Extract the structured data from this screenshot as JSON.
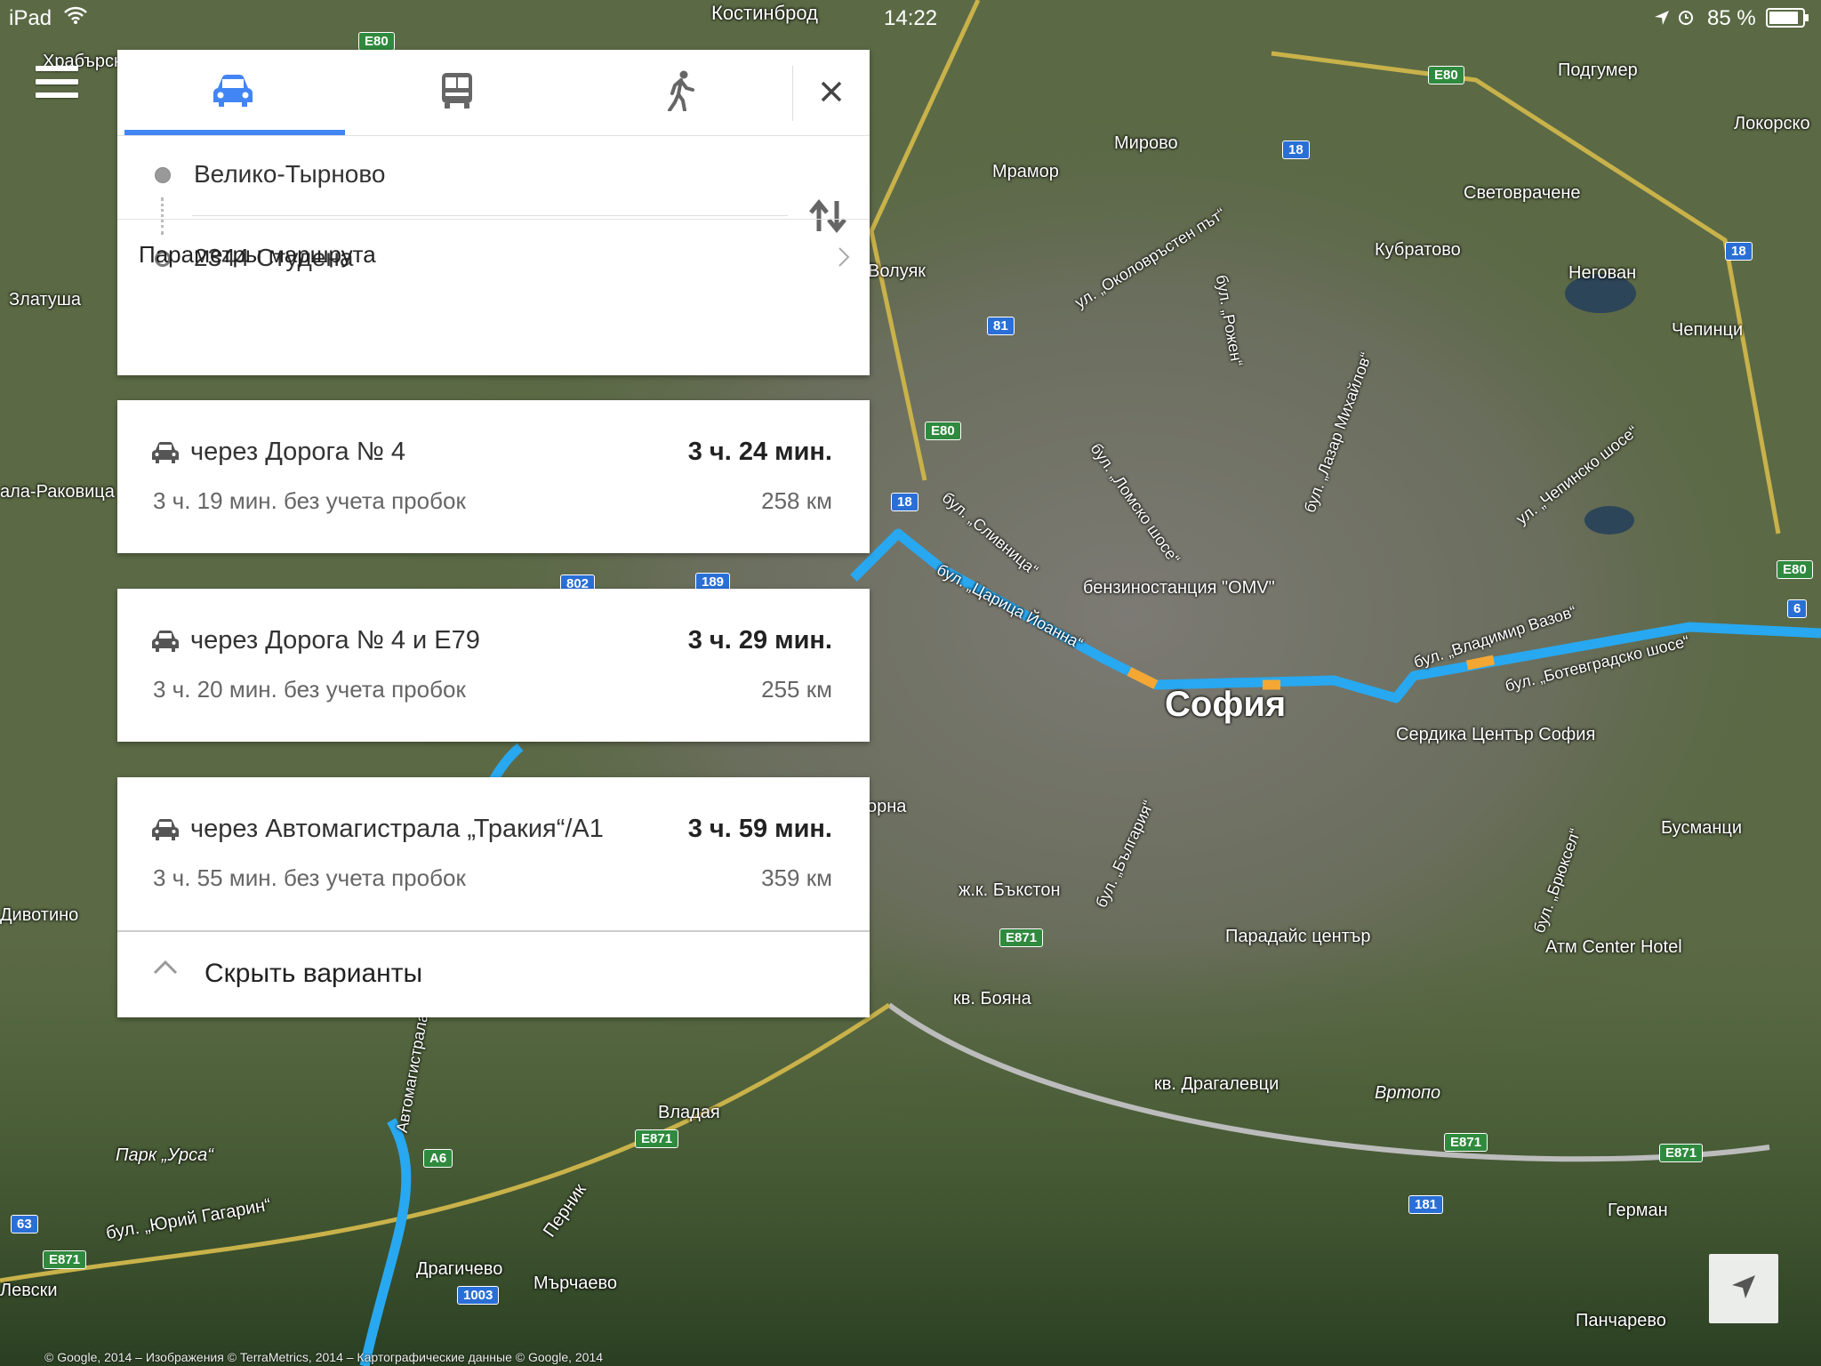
{
  "status_bar": {
    "device": "iPad",
    "time": "14:22",
    "battery": "85 %"
  },
  "modes": [
    {
      "name": "car-tab",
      "icon": "car-icon",
      "active": true
    },
    {
      "name": "transit-tab",
      "icon": "bus-icon",
      "active": false
    },
    {
      "name": "walk-tab",
      "icon": "walk-icon",
      "active": false
    }
  ],
  "route": {
    "origin": "Велико-Тырново",
    "destination": "2344 Студена"
  },
  "params_label": "Параметры маршрута",
  "options": [
    {
      "via": "через Дорога № 4",
      "duration": "3 ч. 24 мин.",
      "sub": "3 ч. 19 мин. без учета пробок",
      "distance": "258 км"
    },
    {
      "via": "через Дорога № 4 и E79",
      "duration": "3 ч. 29 мин.",
      "sub": "3 ч. 20 мин. без учета пробок",
      "distance": "255 км"
    },
    {
      "via": "через Автомагистрала „Тракия“/A1",
      "duration": "3 ч. 59 мин.",
      "sub": "3 ч. 55 мин. без учета пробок",
      "distance": "359 км"
    }
  ],
  "hide_label": "Скрыть варианты",
  "map": {
    "city": "София",
    "places": [
      "Костинброд",
      "Храбърско",
      "Мирово",
      "Мрамор",
      "Подгумер",
      "Локорско",
      "Световрачене",
      "Кубратово",
      "Негован",
      "Чепинци",
      "Волуяк",
      "Златуша",
      "ала-Раковица",
      "бензиностанция \"OMV\"",
      "Сердика Център София",
      "Бусманци",
      "ж.к. Бъкстон",
      "Парадайс център",
      "Атм Center Hotel",
      "кв. Бояна",
      "кв. Драгалевци",
      "Вртопо",
      "Дивотино",
      "Парк „Урса“",
      "Владая",
      "Драгичево",
      "Мърчаево",
      "Герман",
      "Панчарево",
      "Перник",
      "бул. „Юрий Гагарин“",
      "Левски",
      "орна"
    ],
    "roads": [
      "E80",
      "18",
      "81",
      "802",
      "189",
      "6",
      "E871",
      "A6",
      "63",
      "1003",
      "181"
    ],
    "streets": [
      "ул. „Околовръстен път“",
      "бул. „Лазар Михайлов“",
      "бул. „Ломско шосе“",
      "бул. „Сливница“",
      "бул. „Царица Йоанна“",
      "бул. „Владимир Вазов“",
      "бул. „Ботевградско шосе“",
      "ул. „Чепинско шосе“",
      "бул. „България“",
      "бул. „Брюксел“",
      "Автомагистрала",
      "бул. „Рожен“"
    ],
    "copyright": "© Google, 2014 – Изображения © TerraMetrics, 2014 – Картографические данные © Google, 2014"
  }
}
